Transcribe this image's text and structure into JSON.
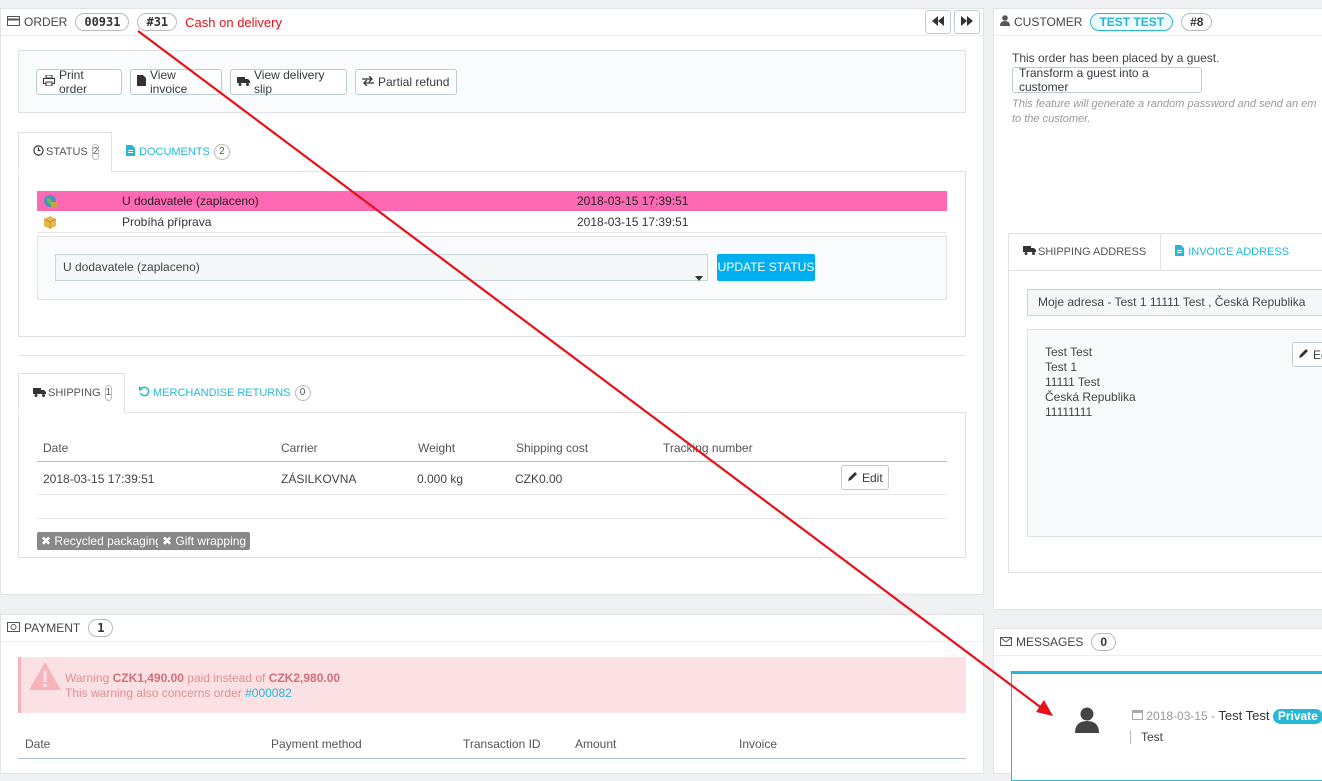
{
  "order": {
    "header_label": "ORDER",
    "order_id": "00931",
    "order_num": "#31",
    "payment_note": "Cash on delivery",
    "nav_prev": "⏪",
    "nav_next": "⏩",
    "buttons": {
      "print": "Print order",
      "invoice": "View invoice",
      "delivery": "View delivery slip",
      "refund": "Partial refund"
    },
    "tabs": {
      "status_label": "STATUS",
      "status_count": "2",
      "documents_label": "DOCUMENTS",
      "documents_count": "2"
    },
    "status_history": [
      {
        "name": "U dodavatele (zaplaceno)",
        "date": "2018-03-15 17:39:51",
        "color": "#ff69b4"
      },
      {
        "name": "Probíhá příprava",
        "date": "2018-03-15 17:39:51",
        "color": "#ffffff"
      }
    ],
    "status_select_value": "U dodavatele (zaplaceno)",
    "update_status_button": "UPDATE STATUS",
    "shipping_tabs": {
      "shipping_label": "SHIPPING",
      "shipping_count": "1",
      "returns_label": "MERCHANDISE RETURNS",
      "returns_count": "0"
    },
    "shipping_table": {
      "headers": [
        "Date",
        "Carrier",
        "Weight",
        "Shipping cost",
        "Tracking number"
      ],
      "row": {
        "date": "2018-03-15 17:39:51",
        "carrier": "ZÁSILKOVNA",
        "weight": "0.000 kg",
        "cost": "CZK0.00",
        "tracking": ""
      },
      "edit_label": "Edit"
    },
    "tags": {
      "recycled": "Recycled packaging",
      "gift": "Gift wrapping"
    }
  },
  "payment": {
    "header_label": "PAYMENT",
    "count": "1",
    "warning": {
      "prefix": "Warning ",
      "paid": "CZK1,490.00",
      "middle": " paid instead of ",
      "due": "CZK2,980.00",
      "line2": "This warning also concerns order ",
      "order_link": "#000082"
    },
    "headers": [
      "Date",
      "Payment method",
      "Transaction ID",
      "Amount",
      "Invoice"
    ]
  },
  "customer": {
    "header_label": "CUSTOMER",
    "name_pill": "TEST TEST",
    "id_pill": "#8",
    "guest_text": "This order has been placed by a guest.",
    "transform_button": "Transform a guest into a customer",
    "feature_note_1": "This feature will generate a random password and send an em",
    "feature_note_2": "to the customer.",
    "address_tabs": {
      "shipping": "SHIPPING ADDRESS",
      "invoice": "INVOICE ADDRESS"
    },
    "address_select": "Moje adresa - Test 1 11111 Test , Česká Republika",
    "address_lines": [
      "Test Test",
      "Test 1",
      "11111 Test",
      "Česká Republika",
      "11111111"
    ],
    "edit_label": "Ed"
  },
  "messages": {
    "header_label": "MESSAGES",
    "count": "0",
    "date": "2018-03-15",
    "separator": " - ",
    "author": "Test Test",
    "badge": "Private",
    "text": "Test"
  },
  "colors": {
    "accent": "#25b9d7",
    "status_pink": "#ff69b4",
    "warning_bg": "#fbe1e3",
    "warning_text": "#e08f95",
    "annotation_red": "#e8101a"
  }
}
